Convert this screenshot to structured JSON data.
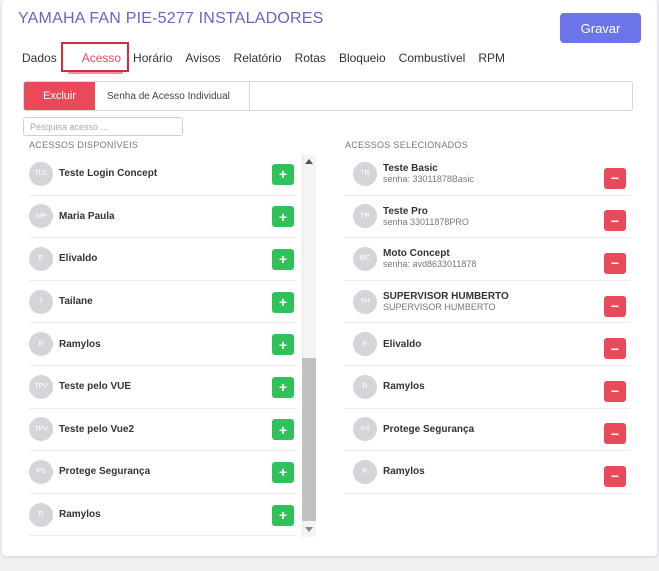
{
  "header": {
    "title": "YAMAHA FAN PIE-5277 INSTALADORES",
    "save_label": "Gravar"
  },
  "tabs": [
    "Dados",
    "Acesso",
    "Horário",
    "Avisos",
    "Relatório",
    "Rotas",
    "Bloqueio",
    "Combustível",
    "RPM"
  ],
  "active_tab": "Acesso",
  "subbar": {
    "delete_label": "Excluir",
    "individual_label": "Senha de Acesso Individual"
  },
  "search": {
    "placeholder": "Pesquisa acesso ...",
    "value": ""
  },
  "available": {
    "heading": "ACESSOS DISPONÍVEIS",
    "items": [
      {
        "initials": "TLC",
        "name": "Teste Login Concept"
      },
      {
        "initials": "MP",
        "name": "Maria Paula"
      },
      {
        "initials": "E",
        "name": "Elivaldo"
      },
      {
        "initials": "T",
        "name": "Tailane"
      },
      {
        "initials": "R",
        "name": "Ramylos"
      },
      {
        "initials": "TPV",
        "name": "Teste pelo VUE"
      },
      {
        "initials": "TPV",
        "name": "Teste pelo Vue2"
      },
      {
        "initials": "PS",
        "name": "Protege Segurança"
      },
      {
        "initials": "R",
        "name": "Ramylos"
      }
    ],
    "add_label": "+"
  },
  "selected": {
    "heading": "ACESSOS SELECIONADOS",
    "items": [
      {
        "initials": "TB",
        "name": "Teste Basic",
        "sub": "senha: 33011878Basic"
      },
      {
        "initials": "TP",
        "name": "Teste Pro",
        "sub": "senha 33011878PRO"
      },
      {
        "initials": "MC",
        "name": "Moto Concept",
        "sub": "senha: avd8633011878"
      },
      {
        "initials": "SH",
        "name": "SUPERVISOR HUMBERTO",
        "sub": "SUPERVISOR HUMBERTO"
      },
      {
        "initials": "E",
        "name": "Elivaldo",
        "sub": ""
      },
      {
        "initials": "R",
        "name": "Ramylos",
        "sub": ""
      },
      {
        "initials": "PS",
        "name": "Protege Segurança",
        "sub": ""
      },
      {
        "initials": "R",
        "name": "Ramylos",
        "sub": ""
      }
    ],
    "remove_label": "−"
  },
  "colors": {
    "accent": "#6b74e8",
    "danger": "#e84a5a",
    "success": "#2fc25b",
    "title": "#6a63c9"
  }
}
